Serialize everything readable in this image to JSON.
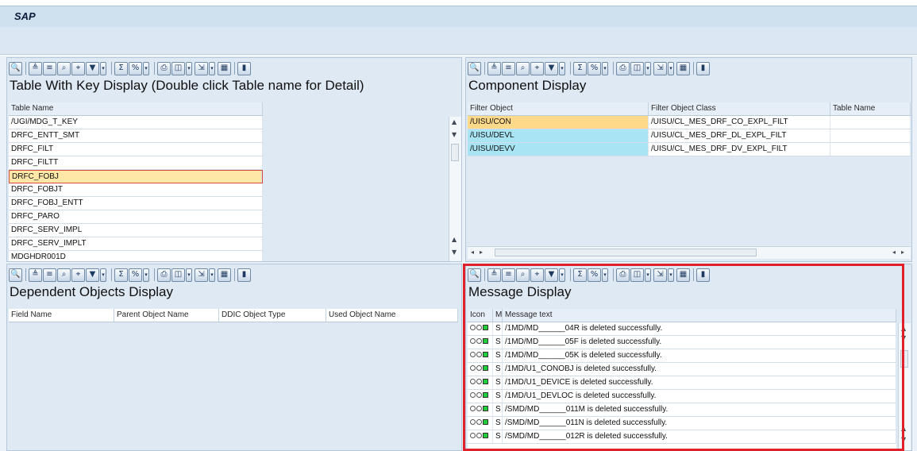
{
  "app": {
    "title": "SAP"
  },
  "toolbar": {
    "buttons": [
      {
        "icon": "details-icon",
        "glyph": "🔍"
      },
      {
        "icon": "sort-ascending-icon",
        "glyph": "≜"
      },
      {
        "icon": "sort-descending-icon",
        "glyph": "≡"
      },
      {
        "icon": "find-icon",
        "glyph": "⌕"
      },
      {
        "icon": "find-next-icon",
        "glyph": "⌖"
      },
      {
        "icon": "filter-icon",
        "glyph": "▼"
      },
      {
        "icon": "sum-icon",
        "glyph": "Σ"
      },
      {
        "icon": "subtotal-icon",
        "glyph": "%"
      },
      {
        "icon": "print-icon",
        "glyph": "⎙"
      },
      {
        "icon": "view-icon",
        "glyph": "◫"
      },
      {
        "icon": "export-icon",
        "glyph": "⇲"
      },
      {
        "icon": "layout-icon",
        "glyph": "▦"
      },
      {
        "icon": "graphic-icon",
        "glyph": "▮"
      }
    ]
  },
  "table_pane": {
    "title": "Table With Key Display (Double click Table name for Detail)",
    "column": "Table Name",
    "rows": [
      "/UGI/MDG_T_KEY",
      "DRFC_ENTT_SMT",
      "DRFC_FILT",
      "DRFC_FILTT",
      "DRFC_FOBJ",
      "DRFC_FOBJT",
      "DRFC_FOBJ_ENTT",
      "DRFC_PARO",
      "DRFC_SERV_IMPL",
      "DRFC_SERV_IMPLT",
      "MDGHDR001D"
    ],
    "selected_index": 4
  },
  "component_pane": {
    "title": "Component Display",
    "columns": [
      "Filter Object",
      "Filter Object Class",
      "Table Name"
    ],
    "rows": [
      {
        "obj": "/UISU/CON",
        "cls": "/UISU/CL_MES_DRF_CO_EXPL_FILT",
        "tbl": ""
      },
      {
        "obj": "/UISU/DEVL",
        "cls": "/UISU/CL_MES_DRF_DL_EXPL_FILT",
        "tbl": ""
      },
      {
        "obj": "/UISU/DEVV",
        "cls": "/UISU/CL_MES_DRF_DV_EXPL_FILT",
        "tbl": ""
      }
    ],
    "row_colors": [
      "#ffd98a",
      "#a8e4f3",
      "#a8e4f3"
    ]
  },
  "dependent_pane": {
    "title": "Dependent Objects Display",
    "columns": [
      "Field Name",
      "Parent Object Name",
      "DDIC Object Type",
      "Used Object Name"
    ]
  },
  "message_pane": {
    "title": "Message Display",
    "columns": [
      "Icon",
      "M",
      "Message text"
    ],
    "rows": [
      {
        "type": "S",
        "text": "/1MD/MD______04R is deleted successfully."
      },
      {
        "type": "S",
        "text": "/1MD/MD______05F is deleted successfully."
      },
      {
        "type": "S",
        "text": "/1MD/MD______05K is deleted successfully."
      },
      {
        "type": "S",
        "text": "/1MD/U1_CONOBJ is deleted successfully."
      },
      {
        "type": "S",
        "text": "/1MD/U1_DEVICE is deleted successfully."
      },
      {
        "type": "S",
        "text": "/1MD/U1_DEVLOC is deleted successfully."
      },
      {
        "type": "S",
        "text": "/SMD/MD______011M is deleted successfully."
      },
      {
        "type": "S",
        "text": "/SMD/MD______011N is deleted successfully."
      },
      {
        "type": "S",
        "text": "/SMD/MD______012R is deleted successfully."
      }
    ],
    "highlight_color": "#e0202a"
  }
}
